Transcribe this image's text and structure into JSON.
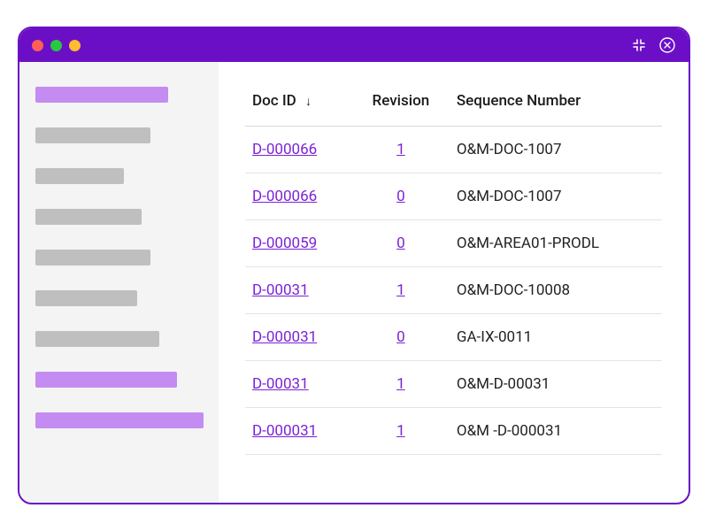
{
  "titlebar": {
    "traffic_lights": [
      "red",
      "yellow",
      "green"
    ],
    "icons": {
      "minimize": "minimize-icon",
      "close": "close-icon"
    }
  },
  "sidebar": {
    "items": [
      {
        "width": 150,
        "active": true
      },
      {
        "width": 130,
        "active": false
      },
      {
        "width": 100,
        "active": false
      },
      {
        "width": 120,
        "active": false
      },
      {
        "width": 130,
        "active": false
      },
      {
        "width": 115,
        "active": false
      },
      {
        "width": 140,
        "active": false
      },
      {
        "width": 160,
        "active": true
      },
      {
        "width": 190,
        "active": true
      }
    ]
  },
  "table": {
    "columns": {
      "doc_id": "Doc ID",
      "revision": "Revision",
      "sequence": "Sequence Number"
    },
    "sort_indicator": "↓",
    "rows": [
      {
        "doc_id": "D-000066",
        "revision": "1",
        "sequence": "O&M-DOC-1007"
      },
      {
        "doc_id": "D-000066",
        "revision": "0",
        "sequence": "O&M-DOC-1007"
      },
      {
        "doc_id": "D-000059",
        "revision": "0",
        "sequence": "O&M-AREA01-PRODL"
      },
      {
        "doc_id": "D-00031",
        "revision": "1",
        "sequence": "O&M-DOC-10008"
      },
      {
        "doc_id": "D-000031",
        "revision": "0",
        "sequence": "GA-IX-0011"
      },
      {
        "doc_id": "D-00031",
        "revision": "1",
        "sequence": "O&M-D-00031"
      },
      {
        "doc_id": "D-000031",
        "revision": "1",
        "sequence": "O&M -D-000031"
      }
    ]
  }
}
